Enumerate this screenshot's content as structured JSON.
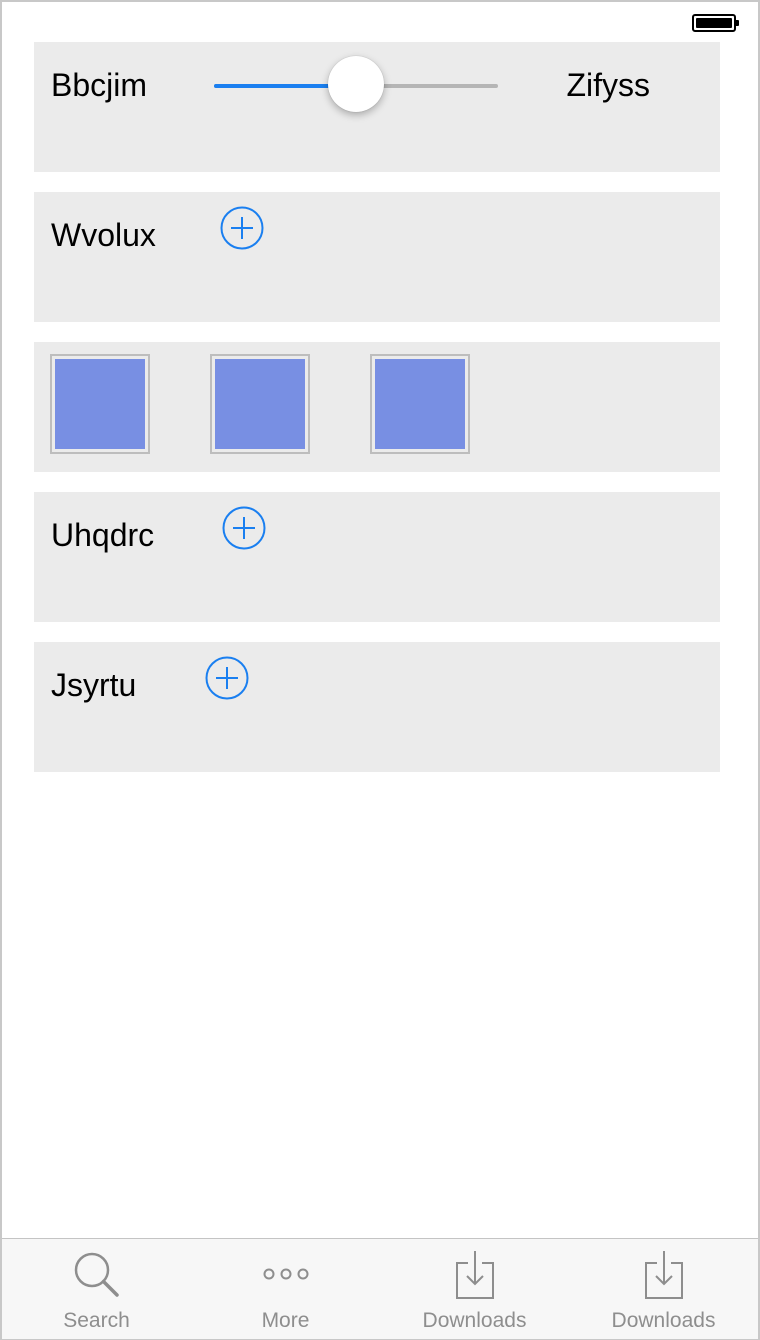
{
  "slider_row": {
    "min_label": "Bbcjim",
    "max_label": "Zifyss",
    "value_fraction": 0.5
  },
  "add_rows": [
    {
      "label": "Wvolux"
    },
    {
      "label": "Uhqdrc"
    },
    {
      "label": "Jsyrtu"
    }
  ],
  "thumbnails": {
    "count": 3,
    "color": "#788fe3"
  },
  "colors": {
    "accent": "#1a7ff0",
    "card_bg": "#ebebeb",
    "tab_inactive": "#8e8e8e"
  },
  "tab_bar": {
    "tabs": [
      {
        "label": "Search",
        "icon": "search-icon"
      },
      {
        "label": "More",
        "icon": "more-icon"
      },
      {
        "label": "Downloads",
        "icon": "downloads-icon"
      },
      {
        "label": "Downloads",
        "icon": "downloads-icon"
      }
    ]
  }
}
